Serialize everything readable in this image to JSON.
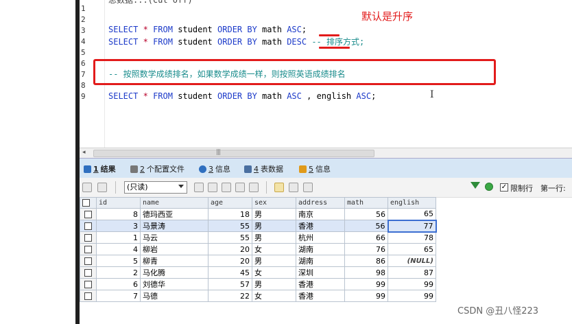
{
  "editor": {
    "top_cut_text": "总数据...(cut off)",
    "lines": [
      {
        "n": "1"
      },
      {
        "n": "2"
      },
      {
        "n": "3"
      },
      {
        "n": "4"
      },
      {
        "n": "5"
      },
      {
        "n": "6"
      },
      {
        "n": "7"
      },
      {
        "n": "8"
      },
      {
        "n": "9"
      }
    ],
    "code3": {
      "select": "SELECT",
      "star": "*",
      "from": "FROM",
      "table": "student",
      "order": "ORDER BY",
      "col": "math",
      "dir": "ASC",
      "end": ";"
    },
    "code4": {
      "select": "SELECT",
      "star": "*",
      "from": "FROM",
      "table": "student",
      "order": "ORDER BY",
      "col": "math",
      "dir": "DESC",
      "comment": "-- 排序方式;"
    },
    "code7": {
      "comment": "-- 按照数学成绩排名，如果数学成绩一样，则按照英语成绩排名"
    },
    "code9": {
      "select": "SELECT",
      "star": "*",
      "from": "FROM",
      "table": "student",
      "order": "ORDER BY",
      "col": "math",
      "dir": "ASC",
      "sep": ",",
      "col2": "english",
      "dir2": "ASC",
      "end": ";"
    }
  },
  "annotation": {
    "default_order": "默认是升序"
  },
  "tabs": [
    {
      "num": "1",
      "label": "结果",
      "icon": "grid-icon",
      "color": "#2f6fbf"
    },
    {
      "num": "2",
      "label": "个配置文件",
      "icon": "profile-icon",
      "color": "#777777"
    },
    {
      "num": "3",
      "label": "信息",
      "icon": "info-icon",
      "color": "#2f6fbf"
    },
    {
      "num": "4",
      "label": "表数据",
      "icon": "table-icon",
      "color": "#4a6fa0"
    },
    {
      "num": "5",
      "label": "信息",
      "icon": "info-icon",
      "color": "#e09a1a"
    }
  ],
  "toolbar": {
    "limit_value": "(只读)",
    "limit_rows_label": "限制行",
    "limit_rows_checked": "✓",
    "first_row_label": "第一行:"
  },
  "grid": {
    "columns": [
      "id",
      "name",
      "age",
      "sex",
      "address",
      "math",
      "english"
    ],
    "rows": [
      [
        "8",
        "德玛西亚",
        "18",
        "男",
        "南京",
        "56",
        "65"
      ],
      [
        "3",
        "马景涛",
        "55",
        "男",
        "香港",
        "56",
        "77"
      ],
      [
        "1",
        "马云",
        "55",
        "男",
        "杭州",
        "66",
        "78"
      ],
      [
        "4",
        "柳岩",
        "20",
        "女",
        "湖南",
        "76",
        "65"
      ],
      [
        "5",
        "柳青",
        "20",
        "男",
        "湖南",
        "86",
        "(NULL)"
      ],
      [
        "2",
        "马化腾",
        "45",
        "女",
        "深圳",
        "98",
        "87"
      ],
      [
        "6",
        "刘德华",
        "57",
        "男",
        "香港",
        "99",
        "99"
      ],
      [
        "7",
        "马德",
        "22",
        "女",
        "香港",
        "99",
        "99"
      ]
    ]
  },
  "watermark": "CSDN @丑八怪223",
  "colors": {
    "annotation_red": "#e21b1b",
    "keyword_blue": "#1c3ac9",
    "comment_teal": "#1a8c8c",
    "tabbar_blue": "#d6e6f5"
  }
}
